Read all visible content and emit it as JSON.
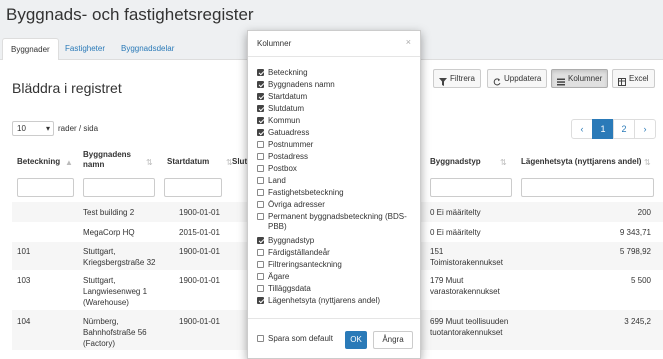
{
  "header": {
    "title": "Byggnads- och fastighetsregister"
  },
  "tabs": [
    {
      "label": "Byggnader",
      "active": true
    },
    {
      "label": "Fastigheter",
      "active": false
    },
    {
      "label": "Byggnadsdelar",
      "active": false
    }
  ],
  "main": {
    "title": "Bläddra i registret",
    "toolbar": {
      "filter": "Filtrera",
      "refresh": "Uppdatera",
      "columns": "Kolumner",
      "excel": "Excel"
    },
    "page_size": {
      "value": "10",
      "suffix": "rader / sida"
    },
    "pager": {
      "prev": "‹",
      "pages": [
        "1",
        "2"
      ],
      "next": "›"
    }
  },
  "table": {
    "headers": {
      "beteckning": "Beteckning",
      "namn_1": "Byggnadens",
      "namn_2": "namn",
      "startdatum": "Startdatum",
      "slut": "Slut",
      "typ": "Byggnadstyp",
      "yta": "Lägenhetsyta (nyttjarens andel)"
    },
    "rows": [
      {
        "beteckning": "",
        "namn": [
          "Test building 2"
        ],
        "startdatum": "1900-01-01",
        "typ": [
          "0 Ei määritelty"
        ],
        "yta": "200"
      },
      {
        "beteckning": "",
        "namn": [
          "MegaCorp HQ"
        ],
        "startdatum": "2015-01-01",
        "typ": [
          "0 Ei määritelty"
        ],
        "yta": "9 343,71"
      },
      {
        "beteckning": "101",
        "namn": [
          "Stuttgart,",
          "Kriegsbergstraße 32"
        ],
        "startdatum": "1900-01-01",
        "typ": [
          "151",
          "Toimistorakennukset"
        ],
        "yta": "5 798,92"
      },
      {
        "beteckning": "103",
        "namn": [
          "Stuttgart,",
          "Langwiesenweg 1",
          "(Warehouse)"
        ],
        "startdatum": "1900-01-01",
        "typ": [
          "179 Muut",
          "varastorakennukset"
        ],
        "yta": "5 500"
      },
      {
        "beteckning": "104",
        "namn": [
          "Nürnberg,",
          "Bahnhofstraße 56",
          "(Factory)"
        ],
        "startdatum": "1900-01-01",
        "typ": [
          "699 Muut teollisuuden",
          "tuotantorakennukset"
        ],
        "yta": "3 245,2"
      }
    ]
  },
  "modal": {
    "title": "Kolumner",
    "close": "×",
    "options": [
      {
        "label": "Beteckning",
        "checked": true
      },
      {
        "label": "Byggnadens namn",
        "checked": true
      },
      {
        "label": "Startdatum",
        "checked": true
      },
      {
        "label": "Slutdatum",
        "checked": true
      },
      {
        "label": "Kommun",
        "checked": true
      },
      {
        "label": "Gatuadress",
        "checked": true
      },
      {
        "label": "Postnummer",
        "checked": false
      },
      {
        "label": "Postadress",
        "checked": false
      },
      {
        "label": "Postbox",
        "checked": false
      },
      {
        "label": "Land",
        "checked": false
      },
      {
        "label": "Fastighetsbeteckning",
        "checked": false
      },
      {
        "label": "Övriga adresser",
        "checked": false
      },
      {
        "label": "Permanent byggnadsbeteckning (BDS-PBB)",
        "checked": false
      },
      {
        "label": "Byggnadstyp",
        "checked": true
      },
      {
        "label": "Färdigställandeår",
        "checked": false
      },
      {
        "label": "Filtreringsanteckning",
        "checked": false
      },
      {
        "label": "Ägare",
        "checked": false
      },
      {
        "label": "Tilläggsdata",
        "checked": false
      },
      {
        "label": "Lägenhetsyta (nyttjarens andel)",
        "checked": true
      }
    ],
    "save_default": {
      "label": "Spara som default",
      "checked": false
    },
    "ok": "OK",
    "cancel": "Ångra"
  },
  "colors": {
    "accent": "#2a7ab8",
    "page_bg": "#eef0f2"
  }
}
